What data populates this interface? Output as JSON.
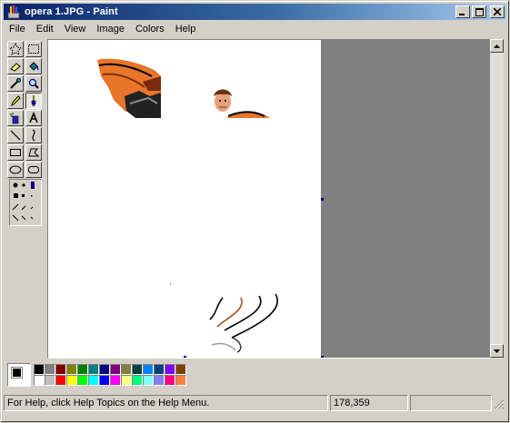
{
  "window": {
    "title": "opera 1.JPG - Paint",
    "controls": {
      "minimize": "minimize",
      "maximize": "maximize",
      "close": "close"
    }
  },
  "menu": [
    "File",
    "Edit",
    "View",
    "Image",
    "Colors",
    "Help"
  ],
  "tools": [
    {
      "name": "free-form-select",
      "icon": "star-select-icon"
    },
    {
      "name": "select",
      "icon": "rect-select-icon"
    },
    {
      "name": "eraser",
      "icon": "eraser-icon"
    },
    {
      "name": "fill",
      "icon": "fill-bucket-icon"
    },
    {
      "name": "pick-color",
      "icon": "eyedropper-icon"
    },
    {
      "name": "magnifier",
      "icon": "magnifier-icon"
    },
    {
      "name": "pencil",
      "icon": "pencil-icon"
    },
    {
      "name": "brush",
      "icon": "brush-icon"
    },
    {
      "name": "airbrush",
      "icon": "airbrush-icon"
    },
    {
      "name": "text",
      "icon": "text-icon"
    },
    {
      "name": "line",
      "icon": "line-icon"
    },
    {
      "name": "curve",
      "icon": "curve-icon"
    },
    {
      "name": "rectangle",
      "icon": "rectangle-icon"
    },
    {
      "name": "polygon",
      "icon": "polygon-icon"
    },
    {
      "name": "ellipse",
      "icon": "ellipse-icon"
    },
    {
      "name": "rounded-rectangle",
      "icon": "rounded-rect-icon"
    }
  ],
  "active_tool": "brush",
  "palette": {
    "foreground": "#000000",
    "background": "#ffffff",
    "colors": [
      "#000000",
      "#808080",
      "#800000",
      "#808000",
      "#008000",
      "#008080",
      "#000080",
      "#800080",
      "#808040",
      "#004040",
      "#0080ff",
      "#004080",
      "#8000ff",
      "#804000",
      "#ffffff",
      "#c0c0c0",
      "#ff0000",
      "#ffff00",
      "#00ff00",
      "#00ffff",
      "#0000ff",
      "#ff00ff",
      "#ffff80",
      "#00ff80",
      "#80ffff",
      "#8080ff",
      "#ff0080",
      "#ff8040"
    ]
  },
  "status": {
    "help": "For Help, click Help Topics on the Help Menu.",
    "coords": "178,359",
    "size": ""
  }
}
